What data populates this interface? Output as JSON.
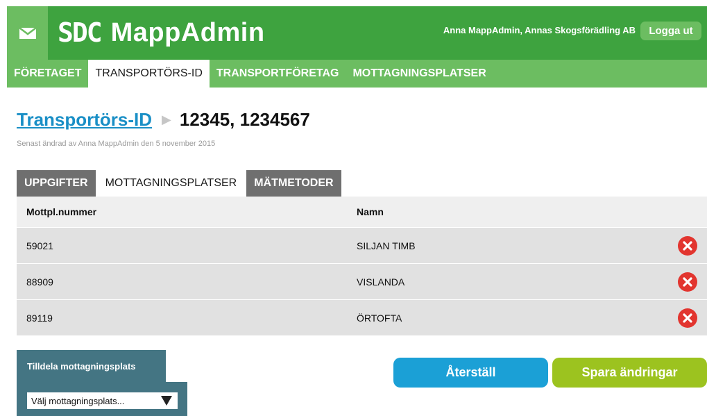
{
  "header": {
    "logo_mark": "SDC",
    "app_name": "MappAdmin",
    "user": "Anna MappAdmin, Annas Skogsförädling AB",
    "logout_label": "Logga ut",
    "mail_icon": "envelope-icon"
  },
  "nav": {
    "items": [
      {
        "label": "FÖRETAGET"
      },
      {
        "label": "TRANSPORTÖRS-ID"
      },
      {
        "label": "TRANSPORTFÖRETAG"
      },
      {
        "label": "MOTTAGNINGSPLATSER"
      }
    ],
    "active": "TRANSPORTÖRS-ID"
  },
  "page": {
    "breadcrumb": "Transportörs-ID",
    "title": "12345, 1234567",
    "subtitle": "Senast ändrad av Anna MappAdmin den 5 november 2015"
  },
  "tabs": {
    "items": [
      {
        "label": "UPPGIFTER"
      },
      {
        "label": "MOTTAGNINGSPLATSER"
      },
      {
        "label": "MÄTMETODER"
      }
    ],
    "active": "MOTTAGNINGSPLATSER"
  },
  "table": {
    "columns": [
      "Mottpl.nummer",
      "Namn"
    ],
    "rows": [
      {
        "number": "59021",
        "name": "SILJAN TIMB"
      },
      {
        "number": "88909",
        "name": "VISLANDA"
      },
      {
        "number": "89119",
        "name": "ÖRTOFTA"
      }
    ]
  },
  "assign": {
    "title": "Tilldela mottagningsplats",
    "select_value": "Välj mottagningsplats..."
  },
  "buttons": {
    "reset_label": "Återställ",
    "save_label": "Spara ändringar"
  },
  "colors": {
    "header_green": "#3ea33f",
    "nav_green": "#6cbd61",
    "link_blue": "#1a8fc6",
    "delete_red": "#e2352f",
    "reset_blue": "#1ba0d6",
    "save_green": "#9cc31f",
    "panel_teal": "#447583"
  }
}
